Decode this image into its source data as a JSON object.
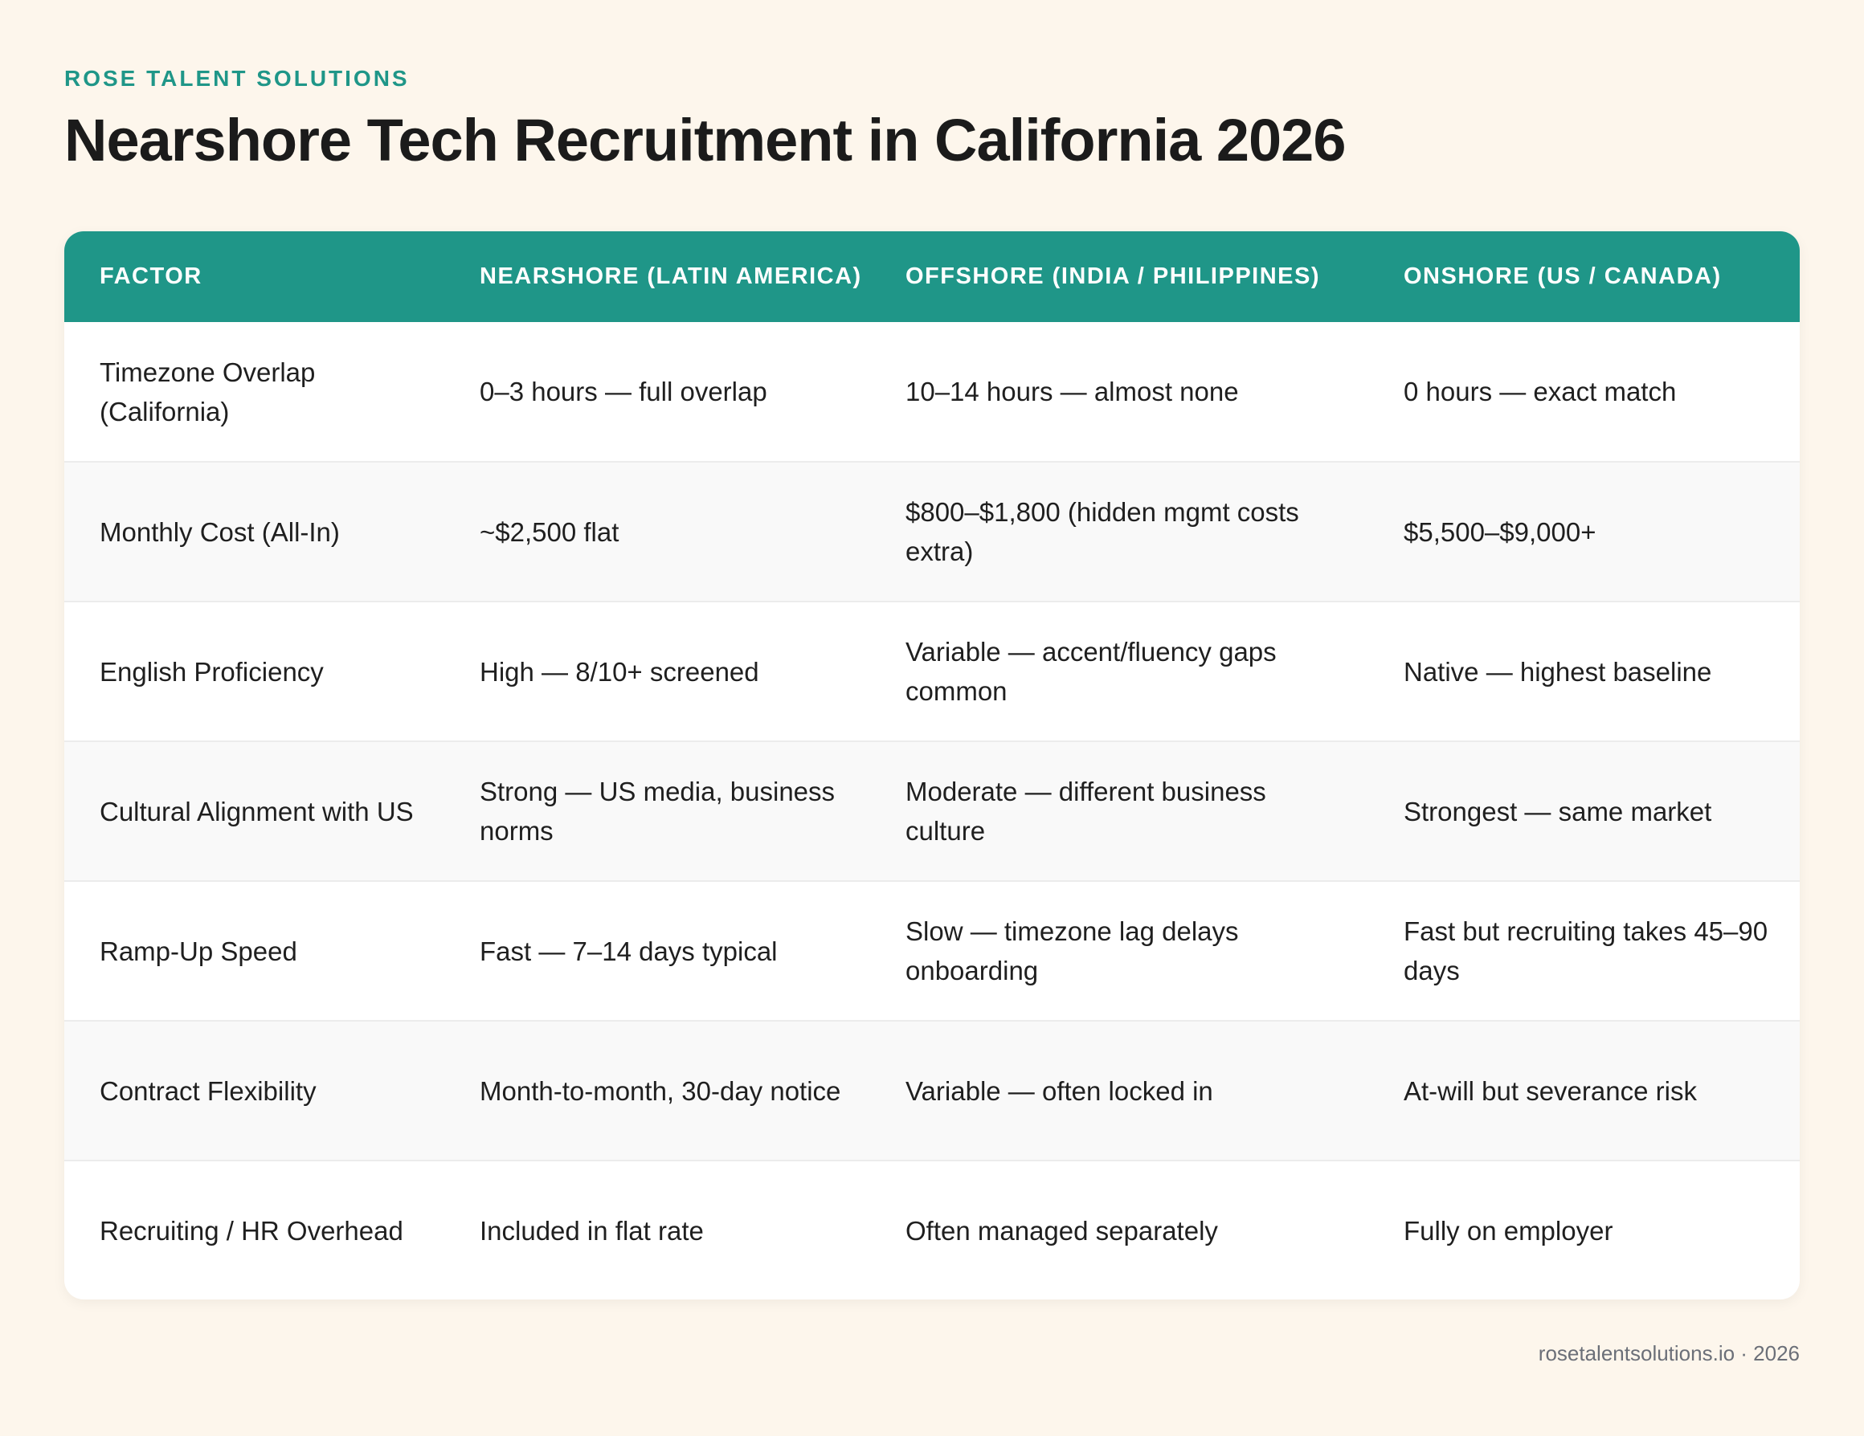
{
  "header": {
    "brand": "ROSE TALENT SOLUTIONS",
    "title": "Nearshore Tech Recruitment in California 2026"
  },
  "table": {
    "columns": [
      "FACTOR",
      "NEARSHORE (LATIN AMERICA)",
      "OFFSHORE (INDIA / PHILIPPINES)",
      "ONSHORE (US / CANADA)"
    ],
    "rows": [
      [
        "Timezone Overlap (California)",
        "0–3 hours — full overlap",
        "10–14 hours — almost none",
        "0 hours — exact match"
      ],
      [
        "Monthly Cost (All-In)",
        "~$2,500 flat",
        "$800–$1,800 (hidden mgmt costs extra)",
        "$5,500–$9,000+"
      ],
      [
        "English Proficiency",
        "High — 8/10+ screened",
        "Variable — accent/fluency gaps common",
        "Native — highest baseline"
      ],
      [
        "Cultural Alignment with US",
        "Strong — US media, business norms",
        "Moderate — different business culture",
        "Strongest — same market"
      ],
      [
        "Ramp-Up Speed",
        "Fast — 7–14 days typical",
        "Slow — timezone lag delays onboarding",
        "Fast but recruiting takes 45–90 days"
      ],
      [
        "Contract Flexibility",
        "Month-to-month, 30-day notice",
        "Variable — often locked in",
        "At-will but severance risk"
      ],
      [
        "Recruiting / HR Overhead",
        "Included in flat rate",
        "Often managed separately",
        "Fully on employer"
      ]
    ]
  },
  "footer": {
    "text": "rosetalentsolutions.io · 2026"
  },
  "colors": {
    "accent": "#1f9688",
    "background": "#fdf6ec",
    "row_alt": "#f9f9f9"
  }
}
